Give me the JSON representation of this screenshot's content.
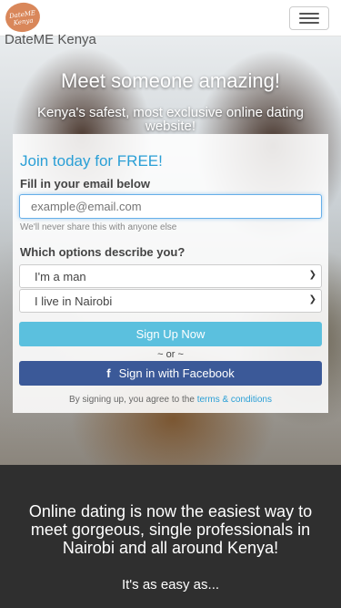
{
  "nav": {
    "logo_text": "DateME Kenya",
    "brand": "DateME Kenya",
    "menu_icon": "hamburger-icon"
  },
  "hero": {
    "title": "Meet someone amazing!",
    "subtitle": "Kenya's safest, most exclusive online dating website!"
  },
  "form": {
    "heading": "Join today for FREE!",
    "email_label": "Fill in your email below",
    "email_placeholder": "example@email.com",
    "email_hint": "We'll never share this with anyone else",
    "options_label": "Which options describe you?",
    "gender_selected": "I'm a man",
    "location_selected": "I live in Nairobi",
    "signup_button": "Sign Up Now",
    "or_text": "~ or ~",
    "facebook_button": "Sign in with Facebook",
    "terms_prefix": "By signing up, you agree to the",
    "terms_link": "terms & conditions"
  },
  "bottom": {
    "headline": "Online dating is now the easiest way to meet gorgeous, single professionals in Nairobi and all around Kenya!",
    "subline": "It's as easy as..."
  },
  "colors": {
    "accent": "#2a9fd6",
    "signup": "#5bc0de",
    "facebook": "#3b5998",
    "dark": "#2f2f2f"
  }
}
